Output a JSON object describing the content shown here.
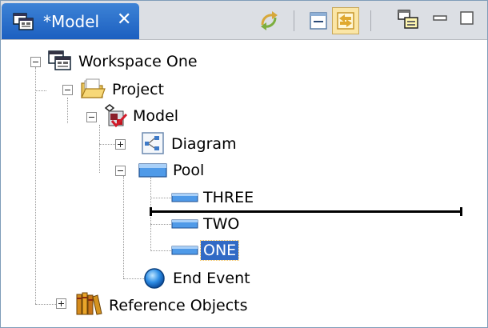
{
  "tab": {
    "title": "*Model",
    "close": "✕"
  },
  "toolbar": {
    "sync_icon": "sync-arrows-icon",
    "collapse_icon": "collapse-all-icon",
    "link_icon": "link-with-editor-icon",
    "view_menu_icon": "view-menu-icon",
    "minimize_icon": "minimize-icon",
    "maximize_icon": "maximize-icon",
    "link_toggled": true
  },
  "tree": {
    "workspace": {
      "label": "Workspace One",
      "icon": "workspace-icon",
      "expanded": true
    },
    "project": {
      "label": "Project",
      "icon": "folder-open-icon",
      "expanded": true
    },
    "model": {
      "label": "Model",
      "icon": "model-icon",
      "expanded": true
    },
    "diagram": {
      "label": "Diagram",
      "icon": "diagram-icon",
      "expanded": false
    },
    "pool": {
      "label": "Pool",
      "icon": "pool-icon",
      "expanded": true
    },
    "lanes": [
      {
        "label": "THREE",
        "icon": "lane-icon",
        "selected": false
      },
      {
        "label": "TWO",
        "icon": "lane-icon",
        "selected": false
      },
      {
        "label": "ONE",
        "icon": "lane-icon",
        "selected": true
      }
    ],
    "end_event": {
      "label": "End Event",
      "icon": "end-event-icon"
    },
    "reference_objects": {
      "label": "Reference Objects",
      "icon": "books-icon",
      "expanded": false
    }
  },
  "drop_indicator": {
    "between": [
      "THREE",
      "TWO"
    ]
  },
  "colors": {
    "tab_active": "#2a70cc",
    "selection": "#316ac5",
    "titlebar": "#dcdfe4"
  }
}
